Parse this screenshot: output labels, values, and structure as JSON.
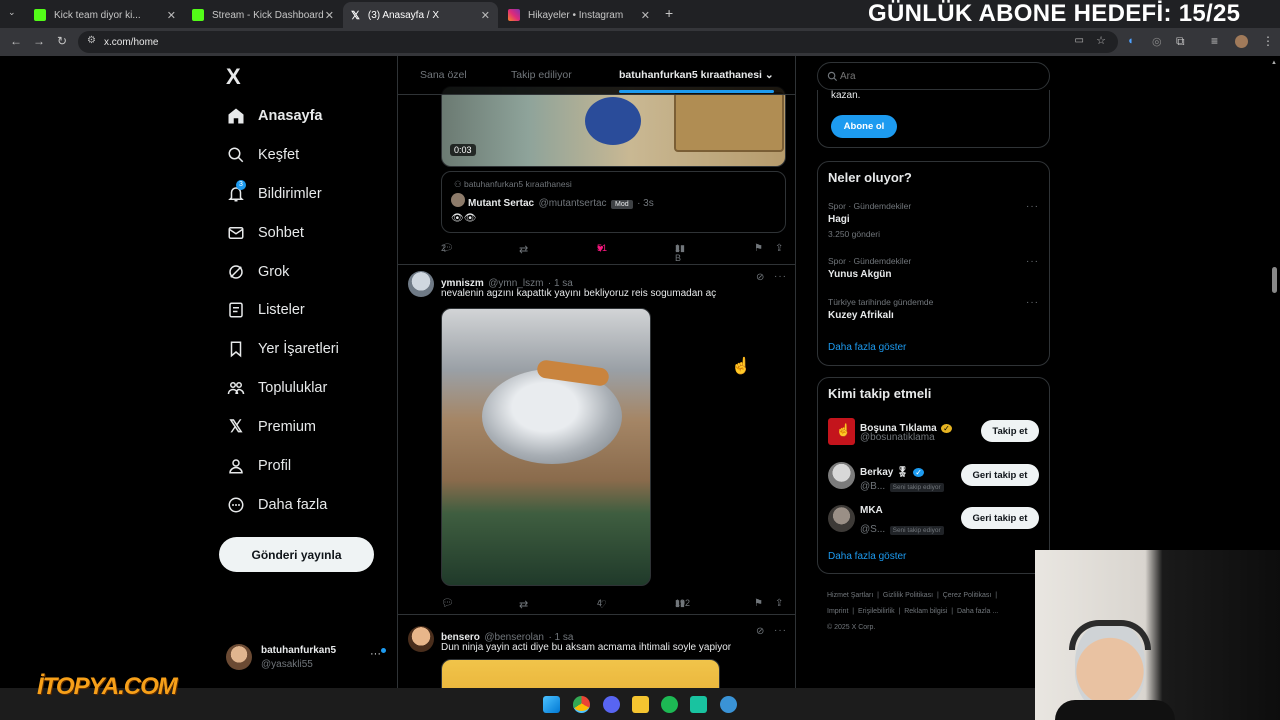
{
  "browser": {
    "tabs": [
      {
        "label": "Kick team diyor ki...",
        "color": "#53fc18"
      },
      {
        "label": "Stream - Kick Dashboard",
        "color": "#53fc18"
      },
      {
        "label": "(3) Anasayfa / X",
        "color": "#ffffff"
      },
      {
        "label": "Hikayeler • Instagram",
        "color": "#e1306c"
      }
    ],
    "url": "x.com/home"
  },
  "overlay": {
    "goal": "GÜNLÜK ABONE HEDEFİ: 15/25",
    "watermark": "İTOPYA.COM"
  },
  "nav": {
    "logo": "X",
    "items": [
      {
        "label": "Anasayfa",
        "icon": "home-icon"
      },
      {
        "label": "Keşfet",
        "icon": "search-icon"
      },
      {
        "label": "Bildirimler",
        "icon": "bell-icon",
        "badge": "3"
      },
      {
        "label": "Sohbet",
        "icon": "mail-icon"
      },
      {
        "label": "Grok",
        "icon": "grok-icon"
      },
      {
        "label": "Listeler",
        "icon": "list-icon"
      },
      {
        "label": "Yer İşaretleri",
        "icon": "bookmark-icon"
      },
      {
        "label": "Topluluklar",
        "icon": "community-icon"
      },
      {
        "label": "Premium",
        "icon": "x-icon"
      },
      {
        "label": "Profil",
        "icon": "person-icon"
      },
      {
        "label": "Daha fazla",
        "icon": "more-icon"
      }
    ],
    "post_button": "Gönderi yayınla",
    "account": {
      "name": "batuhanfurkan5",
      "handle": "@yasakli55"
    }
  },
  "feed": {
    "tabs": [
      "Sana özel",
      "Takip ediliyor",
      "batuhanfurkan5 kıraathanesi"
    ],
    "tweet1": {
      "video_time": "0:03",
      "community": "batuhanfurkan5 kıraathanesi",
      "quote_name": "Mutant Sertac",
      "quote_handle": "@mutantsertac",
      "quote_badge": "Mod",
      "quote_time": "· 3s",
      "quote_text": "👁👁",
      "replies": "2",
      "likes": "51",
      "views": "1 B"
    },
    "tweet2": {
      "name": "ymniszm",
      "handle": "@ymn_lszm",
      "time": "· 1 sa",
      "text": "nevalenin agzını kapattık yayını bekliyoruz reis sogumadan aç",
      "likes": "4",
      "views": "192"
    },
    "tweet3": {
      "name": "bensero",
      "handle": "@benserolan",
      "time": "· 1 sa",
      "text": "Dun ninja yayin acti diye bu aksam acmama ihtimali soyle yapiyor"
    }
  },
  "right": {
    "search_placeholder": "Ara",
    "premium": {
      "text": "kazan.",
      "button": "Abone ol"
    },
    "trends": {
      "title": "Neler oluyor?",
      "items": [
        {
          "context": "Spor · Gündemdekiler",
          "name": "Hagi",
          "count": "3.250 gönderi"
        },
        {
          "context": "Spor · Gündemdekiler",
          "name": "Yunus Akgün",
          "count": ""
        },
        {
          "context": "Türkiye tarihinde gündemde",
          "name": "Kuzey Afrikalı",
          "count": ""
        }
      ],
      "more": "Daha fazla göster"
    },
    "who": {
      "title": "Kimi takip etmeli",
      "items": [
        {
          "name": "Boşuna Tıklama",
          "handle": "@bosunatiklama",
          "button": "Takip et",
          "chip": ""
        },
        {
          "name": "Berkay 🎖",
          "handle": "@B...",
          "button": "Geri takip et",
          "chip": "Seni takip ediyor"
        },
        {
          "name": "MKA",
          "handle": "@S...",
          "button": "Geri takip et",
          "chip": "Seni takip ediyor"
        }
      ],
      "more": "Daha fazla göster"
    },
    "footer": {
      "line1": [
        "Hizmet Şartları",
        "Gizlilik Politikası",
        "Çerez Politikası"
      ],
      "line2": [
        "Imprint",
        "Erişilebilirlik",
        "Reklam bilgisi",
        "Daha fazla ..."
      ],
      "copyright": "© 2025 X Corp."
    }
  },
  "colors": {
    "accent": "#1d9bf0",
    "like": "#f91880",
    "bg": "#000000",
    "border": "#2f3336"
  }
}
